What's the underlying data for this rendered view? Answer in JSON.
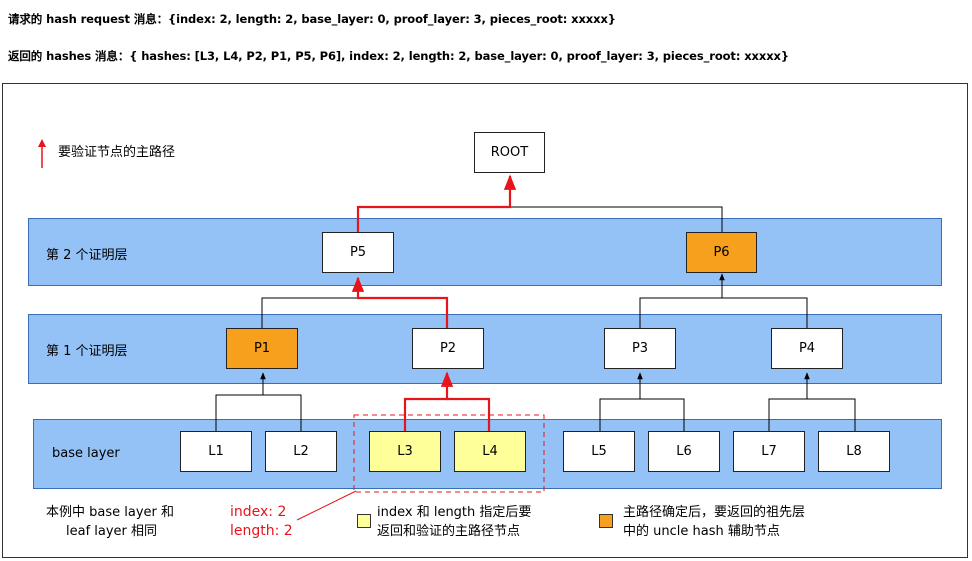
{
  "messages": {
    "request": "请求的 hash request 消息：{index: 2, length: 2, base_layer: 0, proof_layer: 3, pieces_root: xxxxx}",
    "response": "返回的 hashes 消息：{ hashes: [L3, L4, P2, P1, P5, P6], index: 2, length: 2, base_layer: 0, proof_layer: 3, pieces_root: xxxxx}"
  },
  "legend": {
    "main_path": "要验证节点的主路径",
    "main_path_color": "#e8141b",
    "selected_line1": "index 和 length 指定后要",
    "selected_line2": "返回和验证的主路径节点",
    "selected_color": "#ffff99",
    "uncle_line1": "主路径确定后，要返回的祖先层",
    "uncle_line2": "中的 uncle hash 辅助节点",
    "uncle_color": "#f7a01e"
  },
  "layers": {
    "proof2": "第 2 个证明层",
    "proof1": "第 1 个证明层",
    "base": "base layer",
    "fill_color": "#94c2f7"
  },
  "nodes": {
    "root": "ROOT",
    "p5": "P5",
    "p6": "P6",
    "p1": "P1",
    "p2": "P2",
    "p3": "P3",
    "p4": "P4",
    "l1": "L1",
    "l2": "L2",
    "l3": "L3",
    "l4": "L4",
    "l5": "L5",
    "l6": "L6",
    "l7": "L7",
    "l8": "L8"
  },
  "notes": {
    "same_line1": "本例中 base layer 和",
    "same_line2": "leaf layer 相同",
    "index": "index: 2",
    "length": "length: 2"
  }
}
